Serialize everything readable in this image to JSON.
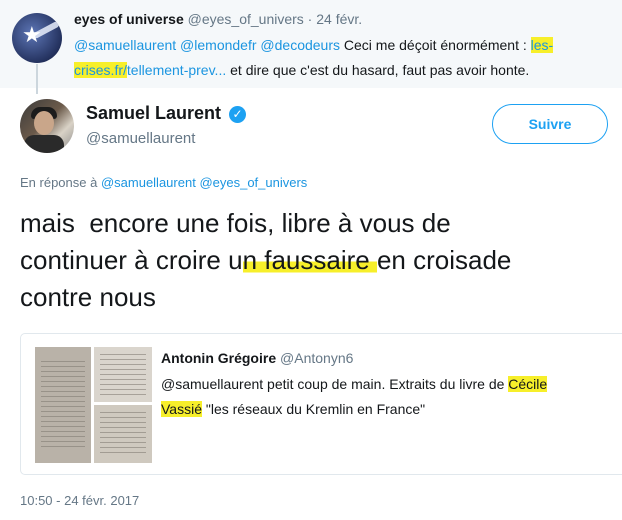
{
  "parent_tweet": {
    "name": "eyes of universe",
    "handle": "@eyes_of_univers",
    "separator": " · ",
    "date": "24 févr.",
    "mention1": "@samuellaurent",
    "mention2": "@lemondefr",
    "mention3": "@decodeurs",
    "text_part1": " Ceci me déçoit énormément : ",
    "link_part1": "les-",
    "link_part2": "crises.fr/",
    "link_rest": "tellement-prev...",
    "text_part2": " et dire que c'est du hasard, faut pas avoir honte."
  },
  "main_tweet": {
    "name": "Samuel Laurent",
    "verified_symbol": "✓",
    "handle": "@samuellaurent",
    "follow_label": "Suivre",
    "reply_prefix": "En réponse à ",
    "reply_mention1": "@samuellaurent",
    "reply_mention2": "@eyes_of_univers",
    "text_part1": "mais  encore une fois, libre à vous de\ncontinuer à croire u",
    "text_highlight": "n faussaire ",
    "text_part2": "en croisade\ncontre nous"
  },
  "quoted_tweet": {
    "name": "Antonin Grégoire",
    "handle": "@Antonyn6",
    "mention": "@samuellaurent",
    "text_part1": " petit coup de main. Extraits du livre de ",
    "highlight1": "Cécile",
    "highlight2": "Vassié",
    "text_part2": " \"les réseaux du Kremlin en France\""
  },
  "timestamp": "10:50 - 24 févr. 2017",
  "colors": {
    "link": "#1b95e0",
    "highlight": "#f7ef2a",
    "verified": "#1da1f2",
    "muted": "#657786"
  }
}
